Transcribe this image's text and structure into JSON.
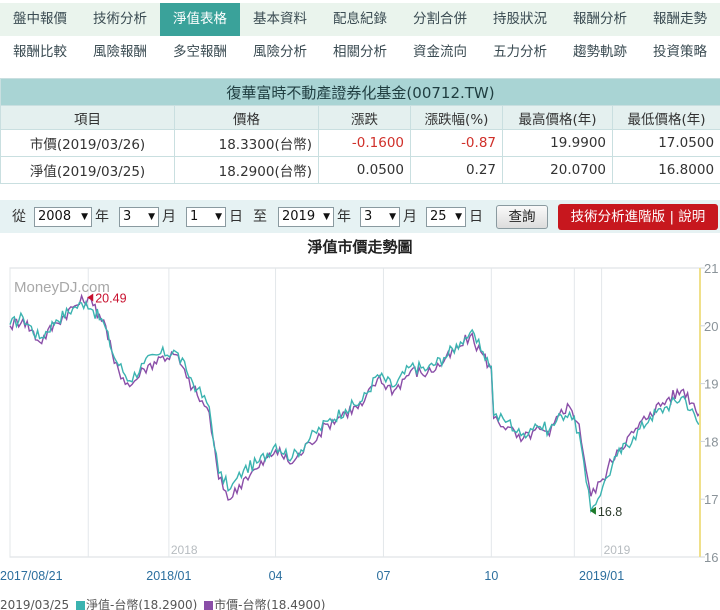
{
  "tabs_row1": [
    "盤中報價",
    "技術分析",
    "淨值表格",
    "基本資料",
    "配息紀錄",
    "分割合併",
    "持股狀況",
    "報酬分析",
    "報酬走勢"
  ],
  "tabs_row2": [
    "報酬比較",
    "風險報酬",
    "多空報酬",
    "風險分析",
    "相關分析",
    "資金流向",
    "五力分析",
    "趨勢軌跡",
    "投資策略"
  ],
  "active_tab": "淨值表格",
  "quote": {
    "title": "復華富時不動產證券化基金(00712.TW)",
    "headers": [
      "項目",
      "價格",
      "漲跌",
      "漲跌幅(%)",
      "最高價格(年)",
      "最低價格(年)"
    ],
    "rows": [
      [
        "市價(2019/03/26)",
        "18.3300(台幣)",
        "-0.1600",
        "-0.87",
        "19.9900",
        "17.0500"
      ],
      [
        "淨值(2019/03/25)",
        "18.2900(台幣)",
        "0.0500",
        "0.27",
        "20.0700",
        "16.8000"
      ]
    ]
  },
  "datebar": {
    "from_label": "從",
    "to_label": "至",
    "year_unit": "年",
    "month_unit": "月",
    "day_unit": "日",
    "from_year": "2008",
    "from_month": "3",
    "from_day": "1",
    "to_year": "2019",
    "to_month": "3",
    "to_day": "25",
    "query_button": "查詢",
    "advanced_button": "技術分析進階版 | 說明"
  },
  "colors": {
    "nav_series": "#3bb3b0",
    "price_series": "#8a4ea8",
    "max_marker": "#c8102e",
    "min_marker": "#1d7a2a",
    "right_axis": "#f0e08a"
  },
  "chart_data": {
    "type": "line",
    "title": "淨值市價走勢圖",
    "watermark": "MoneyDJ.com",
    "x_tick_labels": [
      "2017/08/21",
      "2018/01",
      "04",
      "07",
      "10",
      "2019/01"
    ],
    "year_markers": [
      "2018",
      "2019"
    ],
    "ylim": [
      16,
      21
    ],
    "y_tick_labels": [
      "21",
      "20",
      "19",
      "18",
      "17",
      "16"
    ],
    "annotations": [
      {
        "label": "20.49",
        "x": "2017/10/26",
        "y": 20.49,
        "kind": "max"
      },
      {
        "label": "16.8",
        "x": "2018/12/24",
        "y": 16.8,
        "kind": "min"
      }
    ],
    "series": [
      {
        "name": "淨值-台幣(18.2900)",
        "points": [
          [
            "2017/08/21",
            20.02
          ],
          [
            "2017/09/01",
            20.15
          ],
          [
            "2017/09/15",
            19.78
          ],
          [
            "2017/09/29",
            20.1
          ],
          [
            "2017/10/13",
            20.3
          ],
          [
            "2017/10/24",
            20.41
          ],
          [
            "2017/10/30",
            20.27
          ],
          [
            "2017/11/08",
            20.05
          ],
          [
            "2017/11/17",
            19.45
          ],
          [
            "2017/11/30",
            19.05
          ],
          [
            "2017/12/12",
            19.35
          ],
          [
            "2017/12/26",
            19.52
          ],
          [
            "2018/01/08",
            19.55
          ],
          [
            "2018/01/17",
            19.22
          ],
          [
            "2018/01/26",
            18.9
          ],
          [
            "2018/02/05",
            18.6
          ],
          [
            "2018/02/13",
            17.45
          ],
          [
            "2018/02/23",
            17.18
          ],
          [
            "2018/03/06",
            17.5
          ],
          [
            "2018/03/19",
            17.65
          ],
          [
            "2018/04/02",
            17.95
          ],
          [
            "2018/04/16",
            17.72
          ],
          [
            "2018/05/01",
            18.05
          ],
          [
            "2018/05/16",
            18.35
          ],
          [
            "2018/05/31",
            18.55
          ],
          [
            "2018/06/14",
            18.7
          ],
          [
            "2018/06/27",
            19.15
          ],
          [
            "2018/07/11",
            18.95
          ],
          [
            "2018/07/25",
            19.3
          ],
          [
            "2018/08/08",
            19.25
          ],
          [
            "2018/08/22",
            19.45
          ],
          [
            "2018/09/05",
            19.72
          ],
          [
            "2018/09/13",
            19.88
          ],
          [
            "2018/09/24",
            19.55
          ],
          [
            "2018/10/01",
            19.3
          ],
          [
            "2018/10/03",
            18.45
          ],
          [
            "2018/10/15",
            18.35
          ],
          [
            "2018/10/26",
            18.1
          ],
          [
            "2018/11/07",
            18.3
          ],
          [
            "2018/11/19",
            18.2
          ],
          [
            "2018/11/29",
            18.45
          ],
          [
            "2018/12/06",
            18.5
          ],
          [
            "2018/12/14",
            18.15
          ],
          [
            "2018/12/20",
            17.3
          ],
          [
            "2018/12/24",
            16.8
          ],
          [
            "2019/01/03",
            17.22
          ],
          [
            "2019/01/15",
            17.75
          ],
          [
            "2019/01/29",
            18.08
          ],
          [
            "2019/02/12",
            18.42
          ],
          [
            "2019/02/26",
            18.6
          ],
          [
            "2019/03/12",
            18.78
          ],
          [
            "2019/03/25",
            18.29
          ]
        ]
      },
      {
        "name": "市價-台幣(18.4900)",
        "points": [
          [
            "2017/08/21",
            20.0
          ],
          [
            "2017/09/01",
            20.12
          ],
          [
            "2017/09/15",
            19.72
          ],
          [
            "2017/09/29",
            20.05
          ],
          [
            "2017/10/13",
            20.32
          ],
          [
            "2017/10/26",
            20.49
          ],
          [
            "2017/10/30",
            20.35
          ],
          [
            "2017/11/08",
            20.1
          ],
          [
            "2017/11/17",
            19.35
          ],
          [
            "2017/11/30",
            18.95
          ],
          [
            "2017/12/12",
            19.25
          ],
          [
            "2017/12/26",
            19.45
          ],
          [
            "2018/01/08",
            19.5
          ],
          [
            "2018/01/17",
            19.1
          ],
          [
            "2018/01/26",
            18.8
          ],
          [
            "2018/02/05",
            18.5
          ],
          [
            "2018/02/13",
            17.35
          ],
          [
            "2018/02/23",
            17.0
          ],
          [
            "2018/03/06",
            17.35
          ],
          [
            "2018/03/19",
            17.55
          ],
          [
            "2018/04/02",
            17.85
          ],
          [
            "2018/04/16",
            17.62
          ],
          [
            "2018/05/01",
            17.98
          ],
          [
            "2018/05/16",
            18.3
          ],
          [
            "2018/05/31",
            18.5
          ],
          [
            "2018/06/14",
            18.62
          ],
          [
            "2018/06/27",
            19.08
          ],
          [
            "2018/07/11",
            18.88
          ],
          [
            "2018/07/25",
            19.22
          ],
          [
            "2018/08/08",
            19.18
          ],
          [
            "2018/08/22",
            19.38
          ],
          [
            "2018/09/05",
            19.65
          ],
          [
            "2018/09/13",
            19.82
          ],
          [
            "2018/09/24",
            19.5
          ],
          [
            "2018/10/01",
            19.25
          ],
          [
            "2018/10/03",
            18.4
          ],
          [
            "2018/10/15",
            18.25
          ],
          [
            "2018/10/26",
            18.0
          ],
          [
            "2018/11/07",
            18.2
          ],
          [
            "2018/11/19",
            18.1
          ],
          [
            "2018/11/29",
            18.55
          ],
          [
            "2018/12/06",
            18.6
          ],
          [
            "2018/12/14",
            18.3
          ],
          [
            "2018/12/20",
            17.5
          ],
          [
            "2018/12/24",
            17.05
          ],
          [
            "2019/01/03",
            17.35
          ],
          [
            "2019/01/15",
            17.85
          ],
          [
            "2019/01/29",
            18.15
          ],
          [
            "2019/02/12",
            18.5
          ],
          [
            "2019/02/26",
            18.72
          ],
          [
            "2019/03/12",
            18.9
          ],
          [
            "2019/03/26",
            18.49
          ]
        ]
      }
    ]
  },
  "legend": {
    "date": "2019/03/25",
    "nav_label": "淨值-台幣(18.2900)",
    "price_label": "市價-台幣(18.4900)"
  }
}
